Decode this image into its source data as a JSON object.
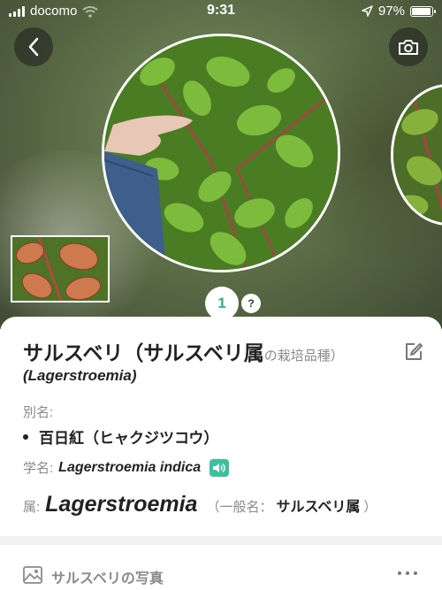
{
  "status_bar": {
    "carrier": "docomo",
    "time": "9:31",
    "battery": "97%",
    "battery_level": 0.97
  },
  "nav": {
    "back_icon": "chevron-left-icon",
    "camera_icon": "camera-icon"
  },
  "pager": {
    "current": "1",
    "help": "?"
  },
  "plant": {
    "name": "サルスベリ",
    "genus_cultivar_open": "（サルスベリ属",
    "genus_cultivar_suffix": "の栽培品種）",
    "latin_paren": "(Lagerstroemia)",
    "alias_label": "別名:",
    "aliases": [
      "百日紅（ヒャクジツコウ）"
    ],
    "scientific_label": "学名:",
    "scientific_name": "Lagerstroemia indica",
    "genus_label": "属:",
    "genus": "Lagerstroemia",
    "genus_common_open": "（一般名：",
    "genus_common": "サルスベリ属",
    "genus_common_close": "）"
  },
  "photos_section": {
    "title": "サルスベリの写真"
  },
  "colors": {
    "accent": "#2fae8e",
    "speaker_bg": "#3cc0a0",
    "muted_text": "#8a8a8a"
  }
}
